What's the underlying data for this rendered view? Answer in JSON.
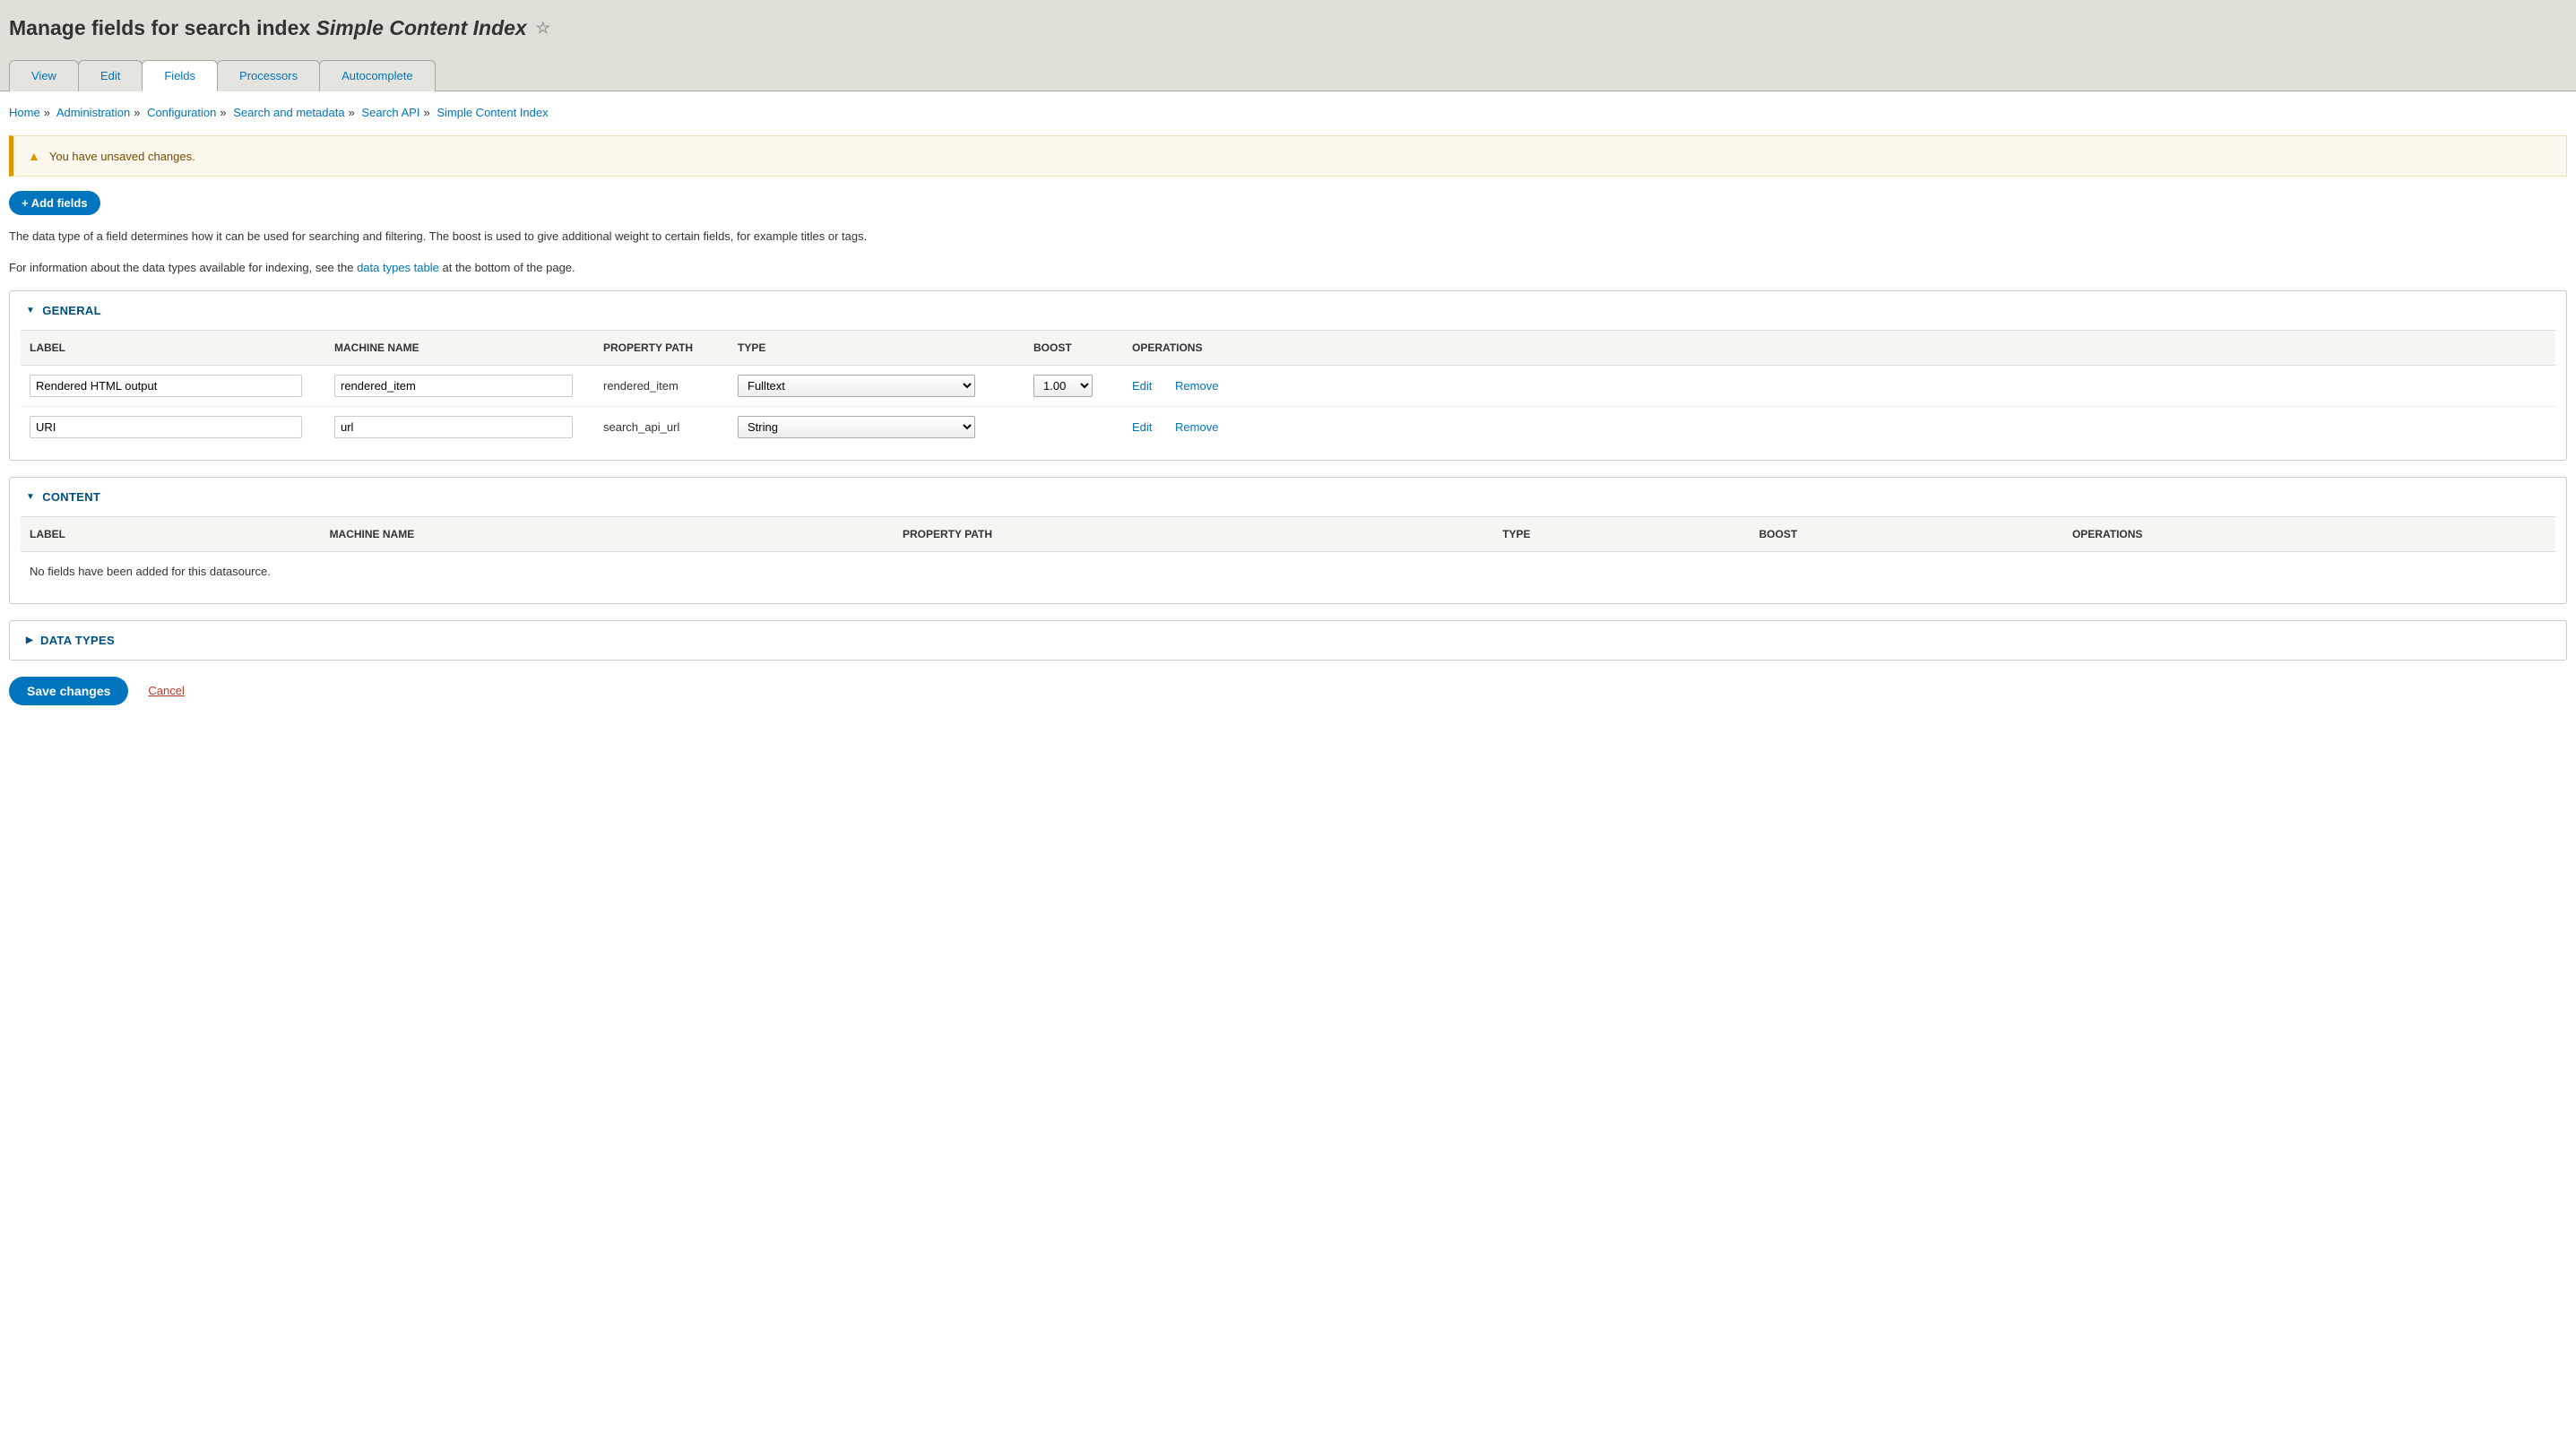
{
  "page_title_prefix": "Manage fields for search index ",
  "page_title_index": "Simple Content Index",
  "tabs": {
    "view": "View",
    "edit": "Edit",
    "fields": "Fields",
    "processors": "Processors",
    "autocomplete": "Autocomplete"
  },
  "breadcrumb": {
    "home": "Home",
    "admin": "Administration",
    "config": "Configuration",
    "search_meta": "Search and metadata",
    "search_api": "Search API",
    "index": "Simple Content Index"
  },
  "warning_message": "You have unsaved changes.",
  "add_fields_label": "+ Add fields",
  "intro": {
    "p1": "The data type of a field determines how it can be used for searching and filtering. The boost is used to give additional weight to certain fields, for example titles or tags.",
    "p2_before": "For information about the data types available for indexing, see the ",
    "p2_link": "data types table",
    "p2_after": " at the bottom of the page."
  },
  "cols": {
    "label": "LABEL",
    "machine_name": "MACHINE NAME",
    "property_path": "PROPERTY PATH",
    "type": "TYPE",
    "boost": "BOOST",
    "operations": "OPERATIONS"
  },
  "sections": {
    "general": {
      "title": "GENERAL",
      "rows": [
        {
          "label": "Rendered HTML output",
          "machine_name": "rendered_item",
          "property_path": "rendered_item",
          "type": "Fulltext",
          "boost": "1.00"
        },
        {
          "label": "URI",
          "machine_name": "url",
          "property_path": "search_api_url",
          "type": "String",
          "boost": ""
        }
      ]
    },
    "content": {
      "title": "CONTENT",
      "empty": "No fields have been added for this datasource."
    },
    "data_types": {
      "title": "DATA TYPES"
    }
  },
  "ops": {
    "edit": "Edit",
    "remove": "Remove"
  },
  "actions": {
    "save": "Save changes",
    "cancel": "Cancel"
  }
}
